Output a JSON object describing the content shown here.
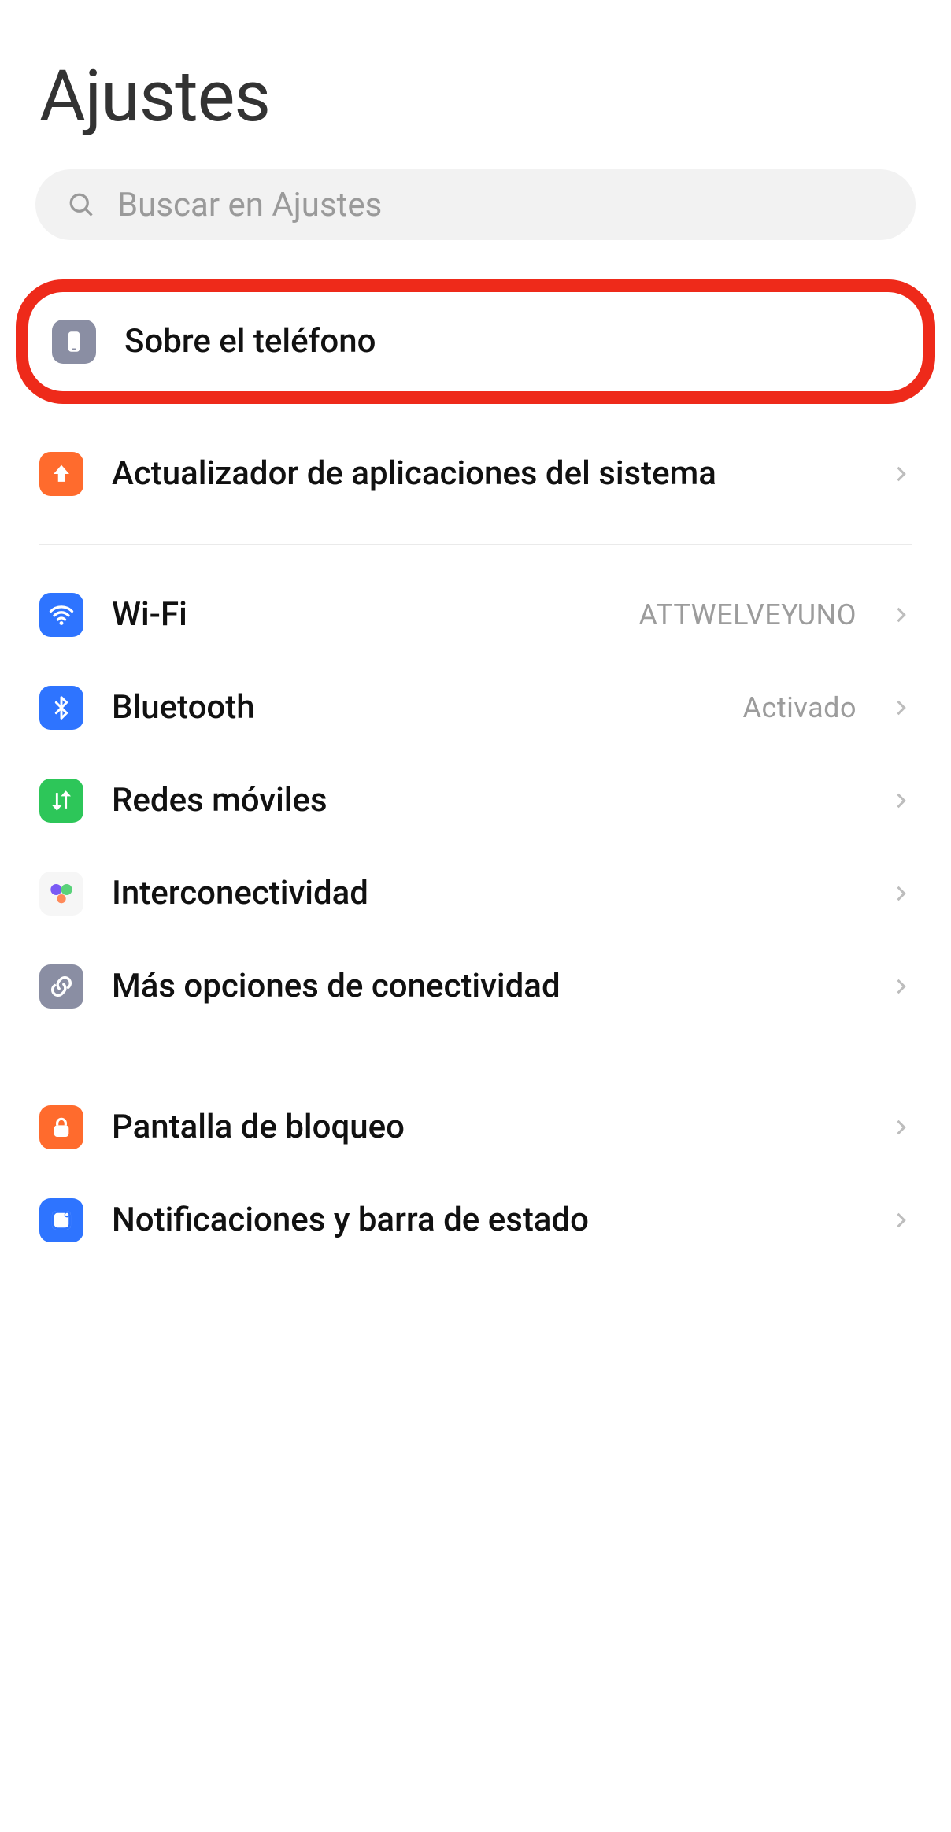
{
  "page": {
    "title": "Ajustes"
  },
  "search": {
    "placeholder": "Buscar en Ajustes"
  },
  "group1": {
    "about": {
      "label": "Sobre el teléfono"
    },
    "updater": {
      "label": "Actualizador de aplicaciones del sistema"
    }
  },
  "group2": {
    "wifi": {
      "label": "Wi-Fi",
      "value": "ATTWELVEYUNO"
    },
    "bluetooth": {
      "label": "Bluetooth",
      "value": "Activado"
    },
    "mobile": {
      "label": "Redes móviles"
    },
    "interconn": {
      "label": "Interconectividad"
    },
    "moreconn": {
      "label": "Más opciones de conectividad"
    }
  },
  "group3": {
    "lock": {
      "label": "Pantalla de bloqueo"
    },
    "notif": {
      "label": "Notificaciones y barra de estado"
    }
  }
}
